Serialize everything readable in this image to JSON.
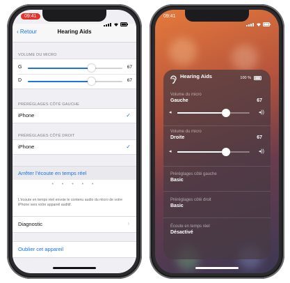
{
  "left": {
    "status_time": "09:41",
    "nav": {
      "back_label": "Retour",
      "title": "Hearing Aids"
    },
    "mic_volume": {
      "header": "VOLUME DU MICRO",
      "left": {
        "label": "G",
        "value": "67",
        "fraction": 0.67
      },
      "right": {
        "label": "D",
        "value": "67",
        "fraction": 0.67
      }
    },
    "presets_left": {
      "header": "PRÉRÉGLAGES CÔTÉ GAUCHE",
      "option": "iPhone",
      "check": "✓"
    },
    "presets_right": {
      "header": "PRÉRÉGLAGES CÔTÉ DROIT",
      "option": "iPhone",
      "check": "✓"
    },
    "live_listen_stop": "Arrêter l’écoute en temps réel",
    "dots": "• • • • •",
    "live_listen_note": "L’écoute en temps réel envoie le contenu audio du micro de votre iPhone vers votre appareil auditif.",
    "diagnostic": "Diagnostic",
    "chevron": "›",
    "forget_device": "Oublier cet appareil"
  },
  "right": {
    "status_time": "09:41",
    "panel": {
      "title": "Hearing Aids",
      "battery": "100 %",
      "left_label": "Volume du micro",
      "left_side": "Gauche",
      "left_value": "67",
      "left_fraction": 0.67,
      "right_label": "Volume du micro",
      "right_side": "Droite",
      "right_value": "67",
      "right_fraction": 0.67,
      "preset_left_label": "Préréglages côté gauche",
      "preset_left_value": "Basic",
      "preset_right_label": "Préréglages côté droit",
      "preset_right_value": "Basic",
      "live_label": "Écoute en temps réel",
      "live_value": "Désactivé"
    }
  },
  "colors": {
    "accent": "#1a73e8",
    "status_red": "#e5322b"
  }
}
